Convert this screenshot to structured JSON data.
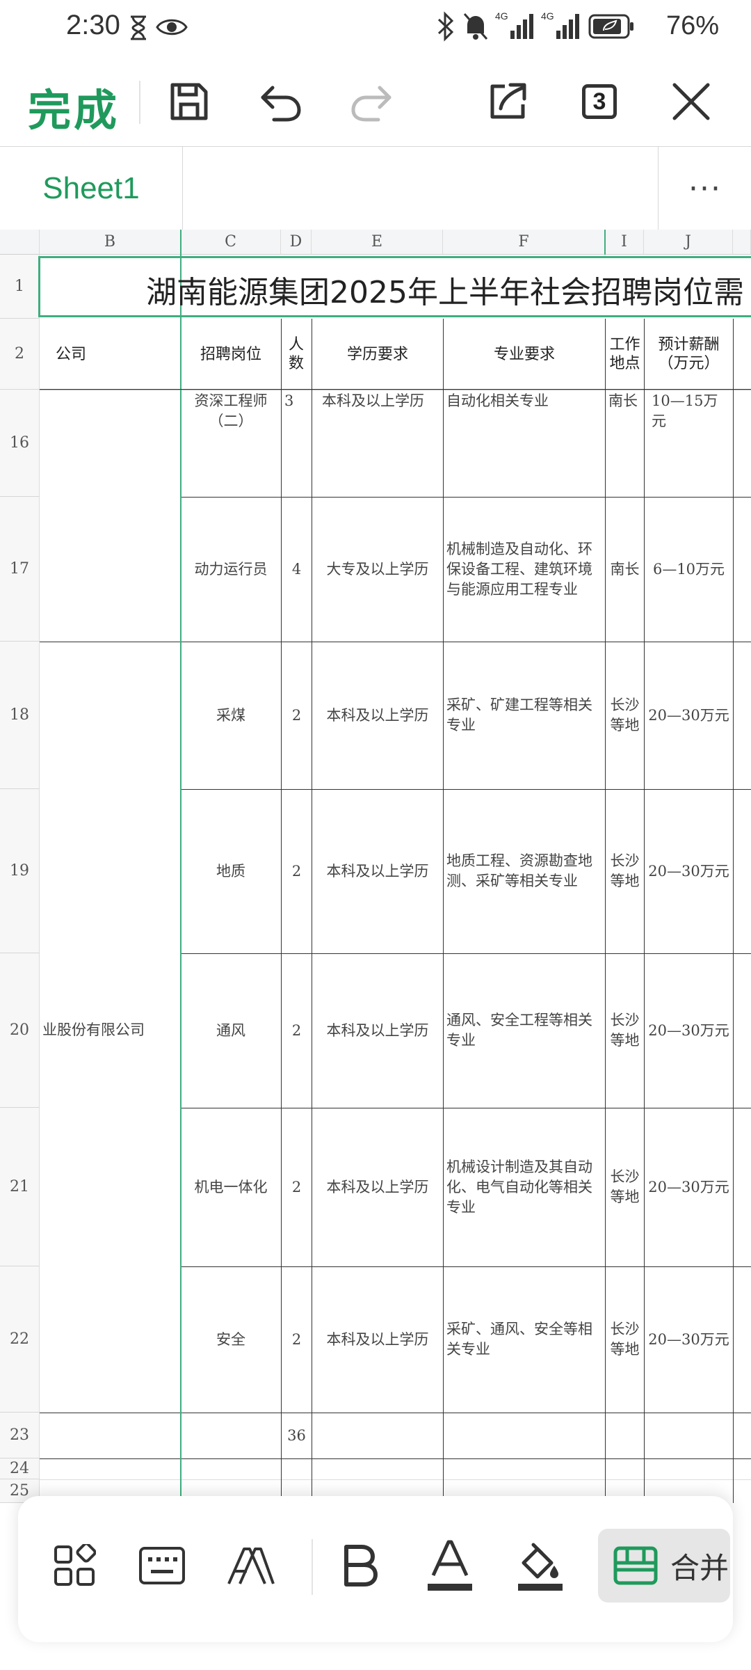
{
  "status": {
    "time": "2:30",
    "battery": "76%",
    "signal1": "4G",
    "signal2": "4G"
  },
  "toolbar": {
    "done_label": "完成",
    "sheet_count": "3"
  },
  "tabs": {
    "active": "Sheet1",
    "more": "···"
  },
  "columns": [
    "B",
    "C",
    "D",
    "E",
    "F",
    "I",
    "J"
  ],
  "rows": [
    "1",
    "2",
    "16",
    "17",
    "18",
    "19",
    "20",
    "21",
    "22",
    "23",
    "24",
    "25"
  ],
  "title": "湖南能源集团2025年上半年社会招聘岗位需",
  "header": {
    "company": "公司",
    "position": "招聘岗位",
    "count": "人数",
    "education": "学历要求",
    "major": "专业要求",
    "location": "工作地点",
    "salary": "预计薪酬（万元）"
  },
  "data_rows": [
    {
      "position": "资深工程师（二）",
      "count": "3",
      "education": "本科及以上学历",
      "major": "自动化相关专业",
      "location": "南长",
      "salary": "10—15万元"
    },
    {
      "position": "动力运行员",
      "count": "4",
      "education": "大专及以上学历",
      "major": "机械制造及自动化、环保设备工程、建筑环境与能源应用工程专业",
      "location": "南长",
      "salary": "6—10万元"
    },
    {
      "position": "采煤",
      "count": "2",
      "education": "本科及以上学历",
      "major": "采矿、矿建工程等相关专业",
      "location": "长沙等地",
      "salary": "20—30万元"
    },
    {
      "position": "地质",
      "count": "2",
      "education": "本科及以上学历",
      "major": "地质工程、资源勘查地测、采矿等相关专业",
      "location": "长沙等地",
      "salary": "20—30万元"
    },
    {
      "position": "通风",
      "count": "2",
      "education": "本科及以上学历",
      "major": "通风、安全工程等相关专业",
      "location": "长沙等地",
      "salary": "20—30万元"
    },
    {
      "position": "机电一体化",
      "count": "2",
      "education": "本科及以上学历",
      "major": "机械设计制造及其自动化、电气自动化等相关专业",
      "location": "长沙等地",
      "salary": "20—30万元"
    },
    {
      "position": "安全",
      "count": "2",
      "education": "本科及以上学历",
      "major": "采矿、通风、安全等相关专业",
      "location": "长沙等地",
      "salary": "20—30万元"
    }
  ],
  "company_merged": "业股份有限公司",
  "total": "36",
  "bottom": {
    "merge_label": "合并"
  },
  "colors": {
    "accent": "#1f9a5c",
    "grid_select": "#3fae7f"
  }
}
